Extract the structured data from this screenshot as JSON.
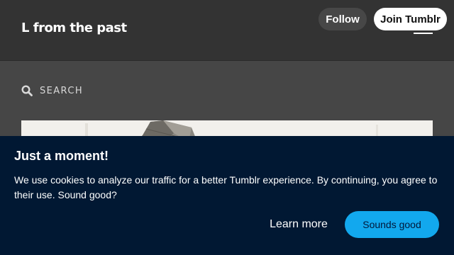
{
  "header": {
    "blog_title": "L from the past",
    "follow_label": "Follow",
    "join_label": "Join Tumblr",
    "menu_icon": "hamburger-menu-icon"
  },
  "search": {
    "label": "SEARCH",
    "icon": "search-icon"
  },
  "cookie_banner": {
    "title": "Just a moment!",
    "message": "We use cookies to analyze our traffic for a better Tumblr experience. By continuing, you agree to their use. Sound good?",
    "learn_more_label": "Learn more",
    "accept_label": "Sounds good"
  },
  "colors": {
    "topbar": "#333333",
    "page_background": "#464646",
    "banner_background": "#011833",
    "accent": "#12a8ee"
  }
}
